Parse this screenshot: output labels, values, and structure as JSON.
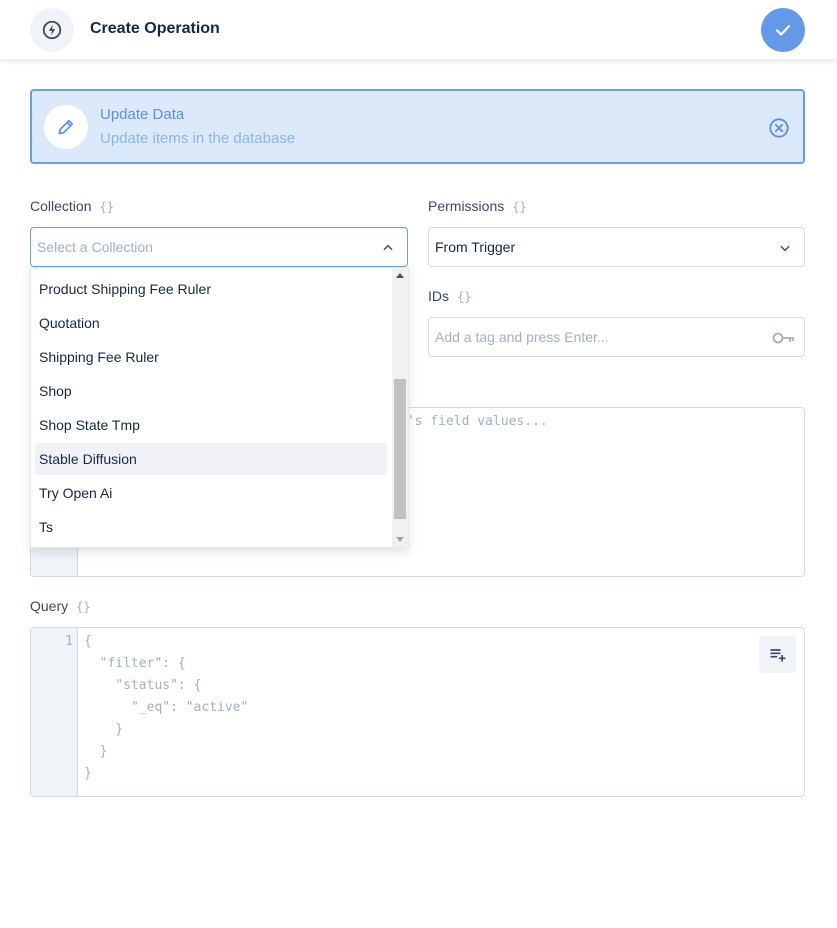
{
  "header": {
    "title": "Create Operation",
    "icon": "bolt-icon",
    "confirm_icon": "check-icon"
  },
  "operation": {
    "title": "Update Data",
    "subtitle": "Update items in the database",
    "icon": "pencil-icon",
    "close_icon": "close-circle-icon"
  },
  "collection": {
    "label": "Collection",
    "braces": "{}",
    "placeholder": "Select a Collection",
    "options": [
      {
        "label": "Product Shipping Fee Ruler"
      },
      {
        "label": "Quotation"
      },
      {
        "label": "Shipping Fee Ruler"
      },
      {
        "label": "Shop"
      },
      {
        "label": "Shop State Tmp"
      },
      {
        "label": "Stable Diffusion"
      },
      {
        "label": "Try Open Ai"
      },
      {
        "label": "Ts"
      }
    ],
    "hovered_option": "Stable Diffusion",
    "scroll_position": 0.62
  },
  "permissions": {
    "label": "Permissions",
    "braces": "{}",
    "value": "From Trigger"
  },
  "ids": {
    "label": "IDs",
    "braces": "{}",
    "placeholder": "Add a tag and press Enter..."
  },
  "payload": {
    "placeholder_fragment": "m's field values..."
  },
  "query": {
    "label": "Query",
    "braces": "{}",
    "line_number": "1",
    "code": "{\n  \"filter\": {\n    \"status\": {\n      \"_eq\": \"active\"\n    }\n  }\n}",
    "format_icon": "playlist-add-icon"
  },
  "colors": {
    "accent": "#6498e8",
    "card_bg": "#dbe9fa",
    "text": "#172940",
    "muted": "#a2b1c6"
  }
}
